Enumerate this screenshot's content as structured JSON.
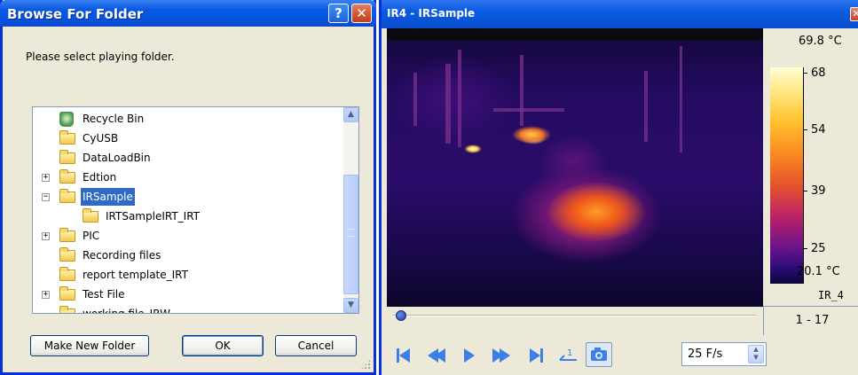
{
  "dialog": {
    "title": "Browse For Folder",
    "help_glyph": "?",
    "close_glyph": "✕",
    "prompt": "Please select playing folder.",
    "tree": [
      {
        "label": "Recycle Bin",
        "icon": "recycle-bin-icon",
        "expander": "",
        "indent": 1
      },
      {
        "label": "CyUSB",
        "icon": "folder-icon",
        "expander": "",
        "indent": 1
      },
      {
        "label": "DataLoadBin",
        "icon": "folder-icon",
        "expander": "",
        "indent": 1
      },
      {
        "label": "Edtion",
        "icon": "folder-icon",
        "expander": "+",
        "indent": 1
      },
      {
        "label": "IRSample",
        "icon": "folder-icon",
        "expander": "−",
        "indent": 1,
        "selected": true
      },
      {
        "label": "IRTSampleIRT_IRT",
        "icon": "folder-icon",
        "expander": "",
        "indent": 2
      },
      {
        "label": "PIC",
        "icon": "folder-icon",
        "expander": "+",
        "indent": 1
      },
      {
        "label": "Recording files",
        "icon": "folder-icon",
        "expander": "",
        "indent": 1
      },
      {
        "label": "report template_IRT",
        "icon": "folder-icon",
        "expander": "",
        "indent": 1
      },
      {
        "label": "Test File",
        "icon": "folder-icon",
        "expander": "+",
        "indent": 1
      },
      {
        "label": "working file_IRW",
        "icon": "folder-icon",
        "expander": "",
        "indent": 1
      }
    ],
    "buttons": {
      "make_new_folder": "Make New Folder",
      "ok": "OK",
      "cancel": "Cancel"
    }
  },
  "viewer": {
    "title": "IR4 - IRSample",
    "close_glyph": "✕",
    "scale": {
      "max": "69.8 °C",
      "min": "20.1 °C",
      "ticks": [
        "68",
        "54",
        "39",
        "25"
      ],
      "channel": "IR_4"
    },
    "frames": "1 - 17",
    "seek_progress": 0.0,
    "fps": "25 F/s",
    "colors": {
      "accent": "#0a5ae0",
      "selection": "#316ac5",
      "transport": "#3c7fe6"
    }
  }
}
